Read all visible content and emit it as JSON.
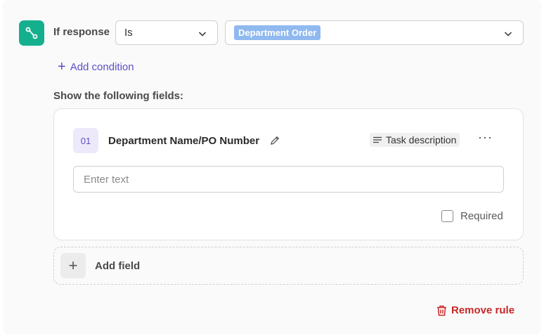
{
  "condition": {
    "if_label": "If response",
    "operator": "Is",
    "value_tag": "Department Order",
    "add_condition_label": "Add condition"
  },
  "section_title": "Show the following fields:",
  "field": {
    "number": "01",
    "name": "Department Name/PO Number",
    "type": "Task description",
    "placeholder": "Enter text",
    "required_label": "Required"
  },
  "add_field_label": "Add field",
  "remove_rule_label": "Remove rule",
  "icons": {
    "rule": "branch-icon",
    "chevron": "chevron-down-icon",
    "edit": "pencil-icon",
    "type": "text-lines-icon",
    "more": "more-horizontal-icon",
    "add": "plus-icon",
    "delete": "trash-icon"
  },
  "colors": {
    "accent": "#14b08d",
    "primary": "#5a4fc4",
    "tag": "#8fb9ef",
    "danger": "#c62828"
  }
}
